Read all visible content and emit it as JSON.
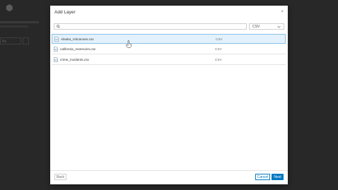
{
  "dialog": {
    "title": "Add Layer",
    "close_glyph": "×"
  },
  "search": {
    "placeholder": "",
    "value": ""
  },
  "type_filter": {
    "selected": "CSV"
  },
  "files": [
    {
      "name": "Alaska_Volcanoes.csv",
      "type": "CSV",
      "selected": true
    },
    {
      "name": "california_reservoirs.csv",
      "type": "CSV",
      "selected": false
    },
    {
      "name": "crime_incidents.csv",
      "type": "CSV",
      "selected": false
    }
  ],
  "footer": {
    "back_label": "Back",
    "cancel_label": "Cancel",
    "next_label": "Next"
  },
  "background": {
    "button_label": "Nx"
  },
  "colors": {
    "accent": "#0079c1",
    "selected_row_bg": "#e2f1fb"
  }
}
